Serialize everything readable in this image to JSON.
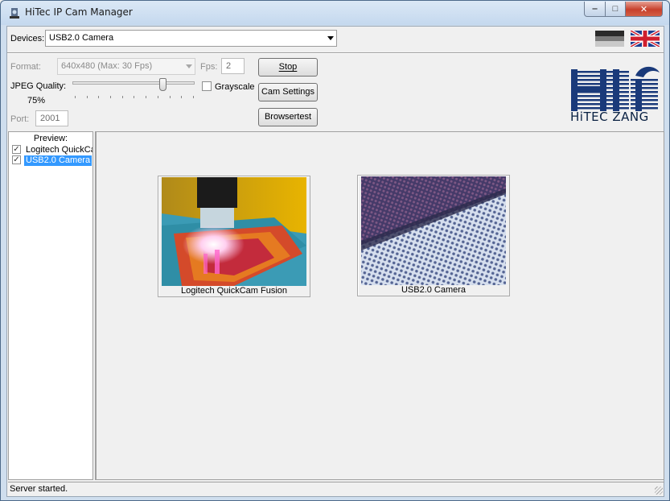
{
  "window": {
    "title": "HiTec IP Cam Manager",
    "controls": {
      "minimize": "‒",
      "maximize": "□",
      "close": "✕"
    }
  },
  "devices": {
    "label": "Devices:",
    "selected": "USB2.0 Camera"
  },
  "languages": [
    {
      "name": "german-flag-icon"
    },
    {
      "name": "uk-flag-icon"
    }
  ],
  "settings": {
    "format_label": "Format:",
    "format_value": "640x480 (Max: 30 Fps)",
    "fps_label": "Fps:",
    "fps_value": "2",
    "jpeg_quality_label": "JPEG Quality:",
    "jpeg_quality_value": "75%",
    "jpeg_quality_level": 0.75,
    "grayscale_label": "Grayscale",
    "grayscale_checked": false,
    "port_label": "Port:",
    "port_value": "2001"
  },
  "buttons": {
    "stop": "Stop",
    "cam_settings": "Cam Settings",
    "browsertest": "Browsertest"
  },
  "logo": {
    "text": "HiTEC ZANG"
  },
  "preview": {
    "label": "Preview:",
    "cameras": [
      {
        "label": "Logitech QuickCam Fusion",
        "checked": true,
        "selected": false
      },
      {
        "label": "USB2.0 Camera",
        "checked": true,
        "selected": true
      }
    ]
  },
  "tiles": [
    {
      "caption": "Logitech QuickCam Fusion",
      "image": "camera-feed-lamp"
    },
    {
      "caption": "USB2.0 Camera",
      "image": "camera-feed-mesh"
    }
  ],
  "status": {
    "text": "Server started."
  },
  "colors": {
    "selection": "#3399ff",
    "logo_blue": "#1a3a7a",
    "close_red": "#c7402c"
  }
}
